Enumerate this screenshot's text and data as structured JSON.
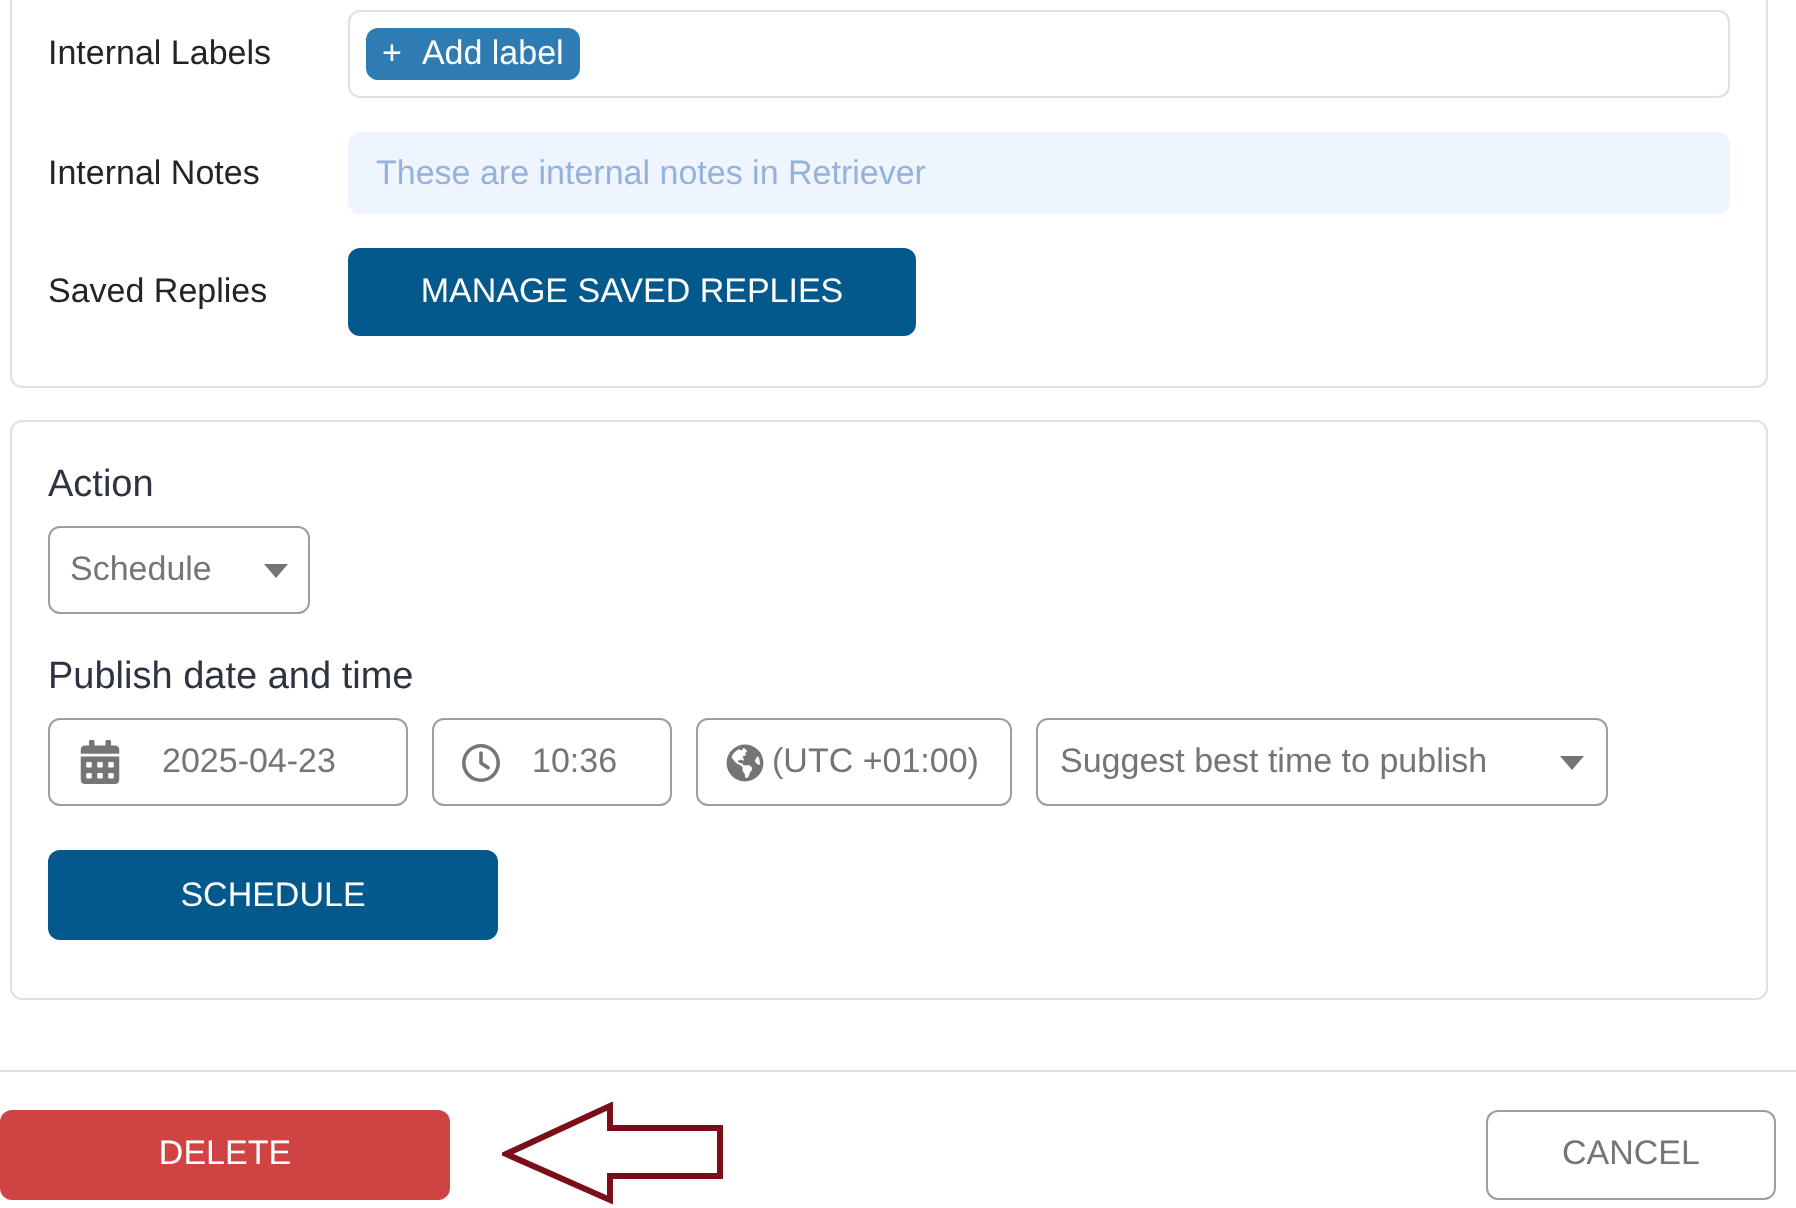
{
  "details": {
    "rows": [
      {
        "kind": "labels",
        "label": "Internal Labels",
        "chip_icon": "+",
        "chip": "Add label"
      },
      {
        "kind": "notes",
        "label": "Internal Notes",
        "placeholder": "These are internal notes in Retriever"
      },
      {
        "kind": "button",
        "label": "Saved Replies",
        "button": "MANAGE SAVED REPLIES"
      }
    ]
  },
  "action": {
    "title": "Action",
    "select": "Schedule"
  },
  "publish": {
    "title": "Publish date and time",
    "date": "2025-04-23",
    "time": "10:36",
    "timezone": "(UTC +01:00)",
    "suggest": "Suggest best time to publish",
    "button": "SCHEDULE"
  },
  "footer": {
    "delete": "DELETE",
    "cancel": "CANCEL"
  }
}
